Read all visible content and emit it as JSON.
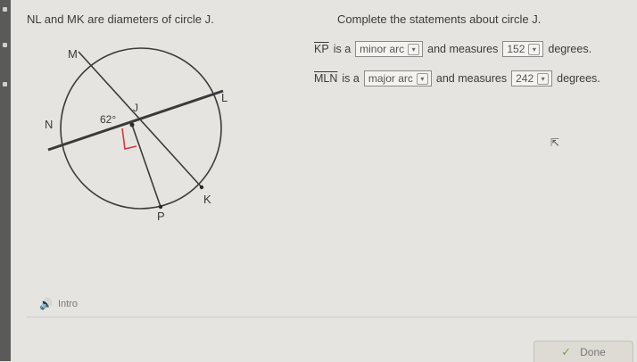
{
  "prompt": "NL and MK are diameters of circle J.",
  "task": "Complete the statements about circle J.",
  "statements": [
    {
      "arc": "KP",
      "is_a": "is a",
      "type_value": "minor arc",
      "and_measures": "and measures",
      "measure_value": "152",
      "unit": "degrees."
    },
    {
      "arc": "MLN",
      "is_a": "is a",
      "type_value": "major arc",
      "and_measures": "and measures",
      "measure_value": "242",
      "unit": "degrees."
    }
  ],
  "diagram": {
    "labels": {
      "M": "M",
      "L": "L",
      "N": "N",
      "K": "K",
      "P": "P",
      "J": "J"
    },
    "angle": "62°"
  },
  "intro_label": "Intro",
  "done_label": "Done",
  "colors": {
    "circle": "#3a3a3a",
    "right_angle": "#d23b3b",
    "background": "#e6e4e0"
  },
  "icons": {
    "speaker": "speaker-icon",
    "check": "check-icon",
    "chevron": "chevron-down-icon"
  }
}
